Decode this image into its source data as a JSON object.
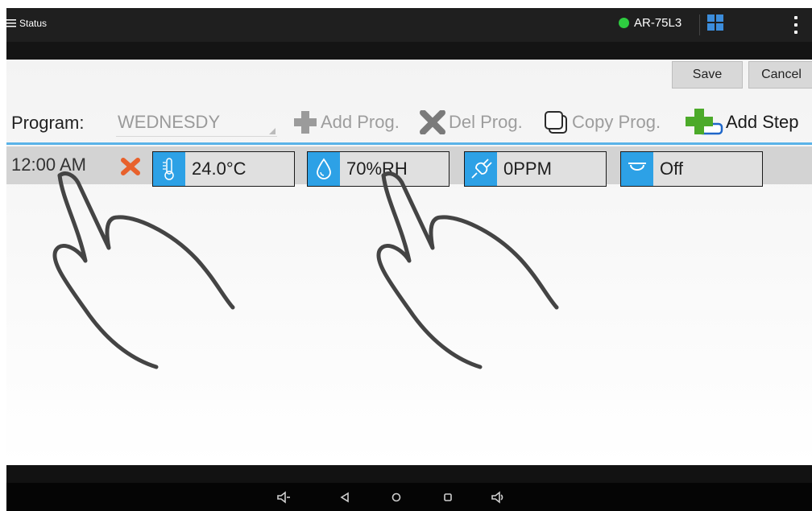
{
  "status_bar": {
    "menu_label": "Status",
    "device_name": "AR-75L3",
    "connection_color": "#2ecc40",
    "icons": [
      "menu-icon",
      "connection-dot-icon",
      "windows-icon",
      "overflow-menu-icon"
    ]
  },
  "toolbar": {
    "save_label": "Save",
    "cancel_label": "Cancel"
  },
  "program": {
    "label": "Program:",
    "selected": "WEDNESDY",
    "actions": {
      "add": "Add Prog.",
      "delete": "Del Prog.",
      "copy": "Copy Prog.",
      "add_step": "Add Step"
    }
  },
  "steps": [
    {
      "time": "12:00 AM",
      "temperature": "24.0°C",
      "humidity": "70%RH",
      "co2": "0PPM",
      "light": "Off"
    }
  ],
  "accent_color": "#2da1e6",
  "nav_icons": [
    "volume-down-icon",
    "back-icon",
    "home-icon",
    "recents-icon",
    "volume-up-icon"
  ]
}
